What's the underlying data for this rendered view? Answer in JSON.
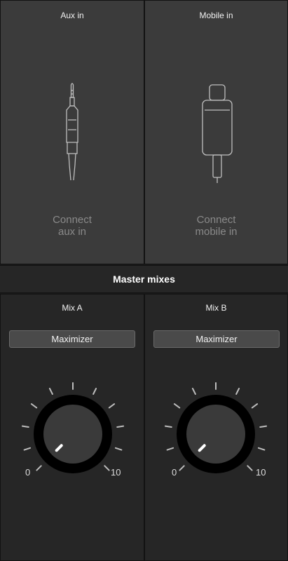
{
  "inputs": {
    "aux": {
      "title": "Aux in",
      "connect_line1": "Connect",
      "connect_line2": "aux in",
      "icon": "aux-jack-icon"
    },
    "mobile": {
      "title": "Mobile in",
      "connect_line1": "Connect",
      "connect_line2": "mobile in",
      "icon": "lightning-connector-icon"
    }
  },
  "master": {
    "title": "Master mixes"
  },
  "mixes": [
    {
      "title": "Mix A",
      "maximizer_label": "Maximizer",
      "scale_min": "0",
      "scale_max": "10",
      "level": 0
    },
    {
      "title": "Mix B",
      "maximizer_label": "Maximizer",
      "scale_min": "0",
      "scale_max": "10",
      "level": 0
    }
  ],
  "colors": {
    "panel_top": "#3b3b3b",
    "panel_bottom": "#262626",
    "knob": "#3a3a3a",
    "knob_ring": "#000000",
    "indicator": "#ffffff"
  }
}
